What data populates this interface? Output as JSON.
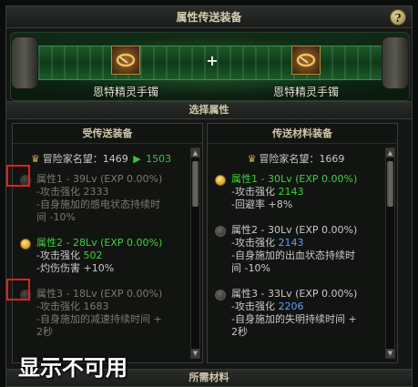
{
  "window": {
    "title": "属性传送装备",
    "help_label": "?"
  },
  "banner": {
    "left_item_name": "恩特精灵手镯",
    "right_item_name": "恩特精灵手镯",
    "plus": "+"
  },
  "select_section": "选择属性",
  "material_section": "所需材料",
  "left_panel": {
    "header": "受传送装备",
    "fame_label": "冒险家名望：",
    "fame_old": "1469",
    "fame_arrow": "▶",
    "fame_new": "1503",
    "entries": [
      {
        "state": "disabled",
        "title": "属性1 - 39Lv (EXP 0.00%)",
        "l1_prefix": "攻击强化 ",
        "l1_val": "2333",
        "l2": "自身施加的感电状态持续时",
        "l3": "间 -10%"
      },
      {
        "state": "active",
        "title": "属性2 - 28Lv (EXP 0.00%)",
        "l1_prefix": "攻击强化 ",
        "l1_val": "502",
        "l2": "灼伤伤害 +10%"
      },
      {
        "state": "disabled",
        "title": "属性3 - 18Lv (EXP 0.00%)",
        "l1_prefix": "攻击强化 ",
        "l1_val": "1683",
        "l2": "自身施加的减速持续时间 +",
        "l3": "2秒"
      }
    ]
  },
  "right_panel": {
    "header": "传送材料装备",
    "fame_label": "冒险家名望：",
    "fame_value": "1669",
    "entries": [
      {
        "state": "selected",
        "title": "属性1 - 30Lv (EXP 0.00%)",
        "l1_prefix": "攻击强化 ",
        "l1_val": "2143",
        "l2": "回避率 +8%"
      },
      {
        "state": "normal",
        "title": "属性2 - 30Lv (EXP 0.00%)",
        "l1_prefix": "攻击强化 ",
        "l1_val": "2143",
        "l2": "自身施加的出血状态持续时",
        "l3": "间 -10%"
      },
      {
        "state": "normal",
        "title": "属性3 - 33Lv (EXP 0.00%)",
        "l1_prefix": "攻击强化 ",
        "l1_val": "2206",
        "l2": "自身施加的失明持续时间 +",
        "l3": "2秒"
      }
    ]
  },
  "caption": "显示不可用",
  "colors": {
    "active_green": "#3ad23a",
    "highlight_blue": "#5aa0ff",
    "disabled_gray": "#7a7a74",
    "annotation_red": "#e02020"
  }
}
